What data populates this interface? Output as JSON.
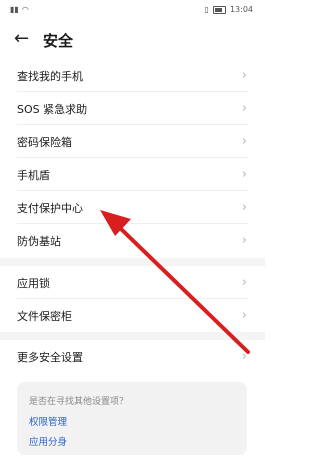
{
  "status": {
    "time": "13:04"
  },
  "header": {
    "title": "安全"
  },
  "group1": [
    {
      "label": "查找我的手机"
    },
    {
      "label": "SOS 紧急求助"
    },
    {
      "label": "密码保险箱"
    },
    {
      "label": "手机盾"
    },
    {
      "label": "支付保护中心"
    },
    {
      "label": "防伪基站"
    }
  ],
  "group2": [
    {
      "label": "应用锁"
    },
    {
      "label": "文件保密柜"
    }
  ],
  "group3": [
    {
      "label": "更多安全设置"
    }
  ],
  "suggest": {
    "question": "是否在寻找其他设置项？",
    "link1": "权限管理",
    "link2": "应用分身"
  },
  "annotation": {
    "color": "#d81e1e",
    "points_to": "支付保护中心"
  }
}
